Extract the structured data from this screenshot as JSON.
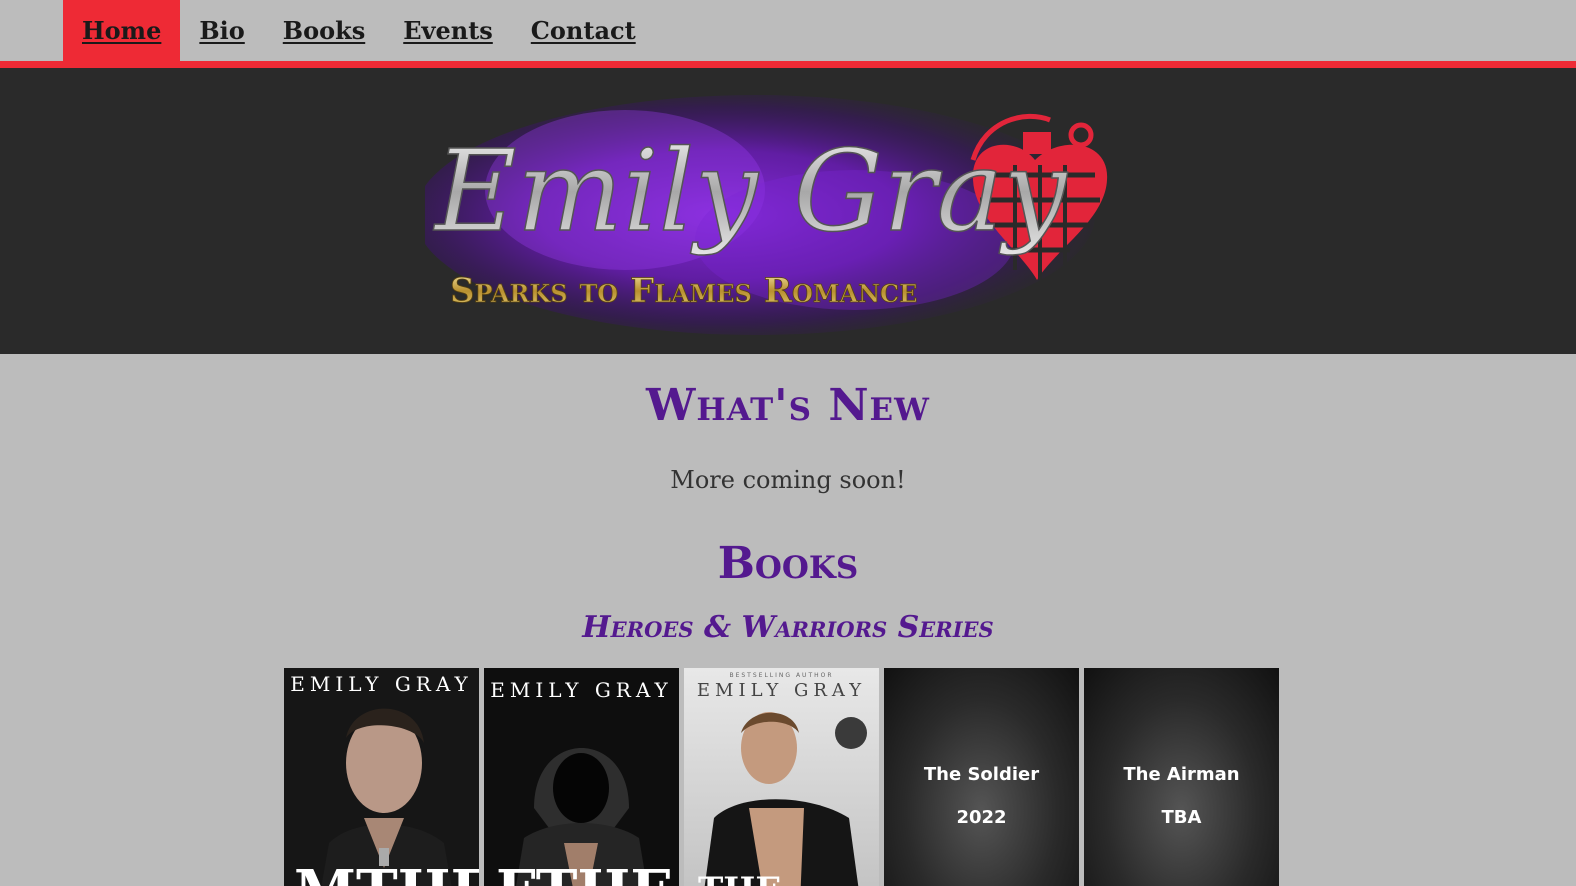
{
  "nav": {
    "items": [
      {
        "label": "Home"
      },
      {
        "label": "Bio"
      },
      {
        "label": "Books"
      },
      {
        "label": "Events"
      },
      {
        "label": "Contact"
      }
    ]
  },
  "logo": {
    "title": "Emily Gray",
    "tagline": "Sparks to Flames Romance"
  },
  "main": {
    "whats_new_heading": "What's New",
    "whats_new_text": "More coming soon!",
    "books_heading": "Books",
    "series_heading": "Heroes & Warriors Series"
  },
  "books": [
    {
      "author": "EMILY GRAY",
      "title_fragment": "MTHE",
      "cover": "hero-photo"
    },
    {
      "author": "EMILY GRAY",
      "title_fragment": "FTHE",
      "cover": "hooded-photo"
    },
    {
      "author": "EMILY GRAY",
      "title_fragment": "THE",
      "cover": "studio-photo",
      "kicker": "BESTSELLING AUTHOR"
    },
    {
      "title": "The Soldier",
      "status": "2022",
      "cover": "placeholder"
    },
    {
      "title": "The Airman",
      "status": "TBA",
      "cover": "placeholder"
    }
  ],
  "colors": {
    "accent": "#ee2a35",
    "heading": "#54198f",
    "header_bg": "#2a2a2a",
    "page_bg": "#bcbcbc"
  }
}
